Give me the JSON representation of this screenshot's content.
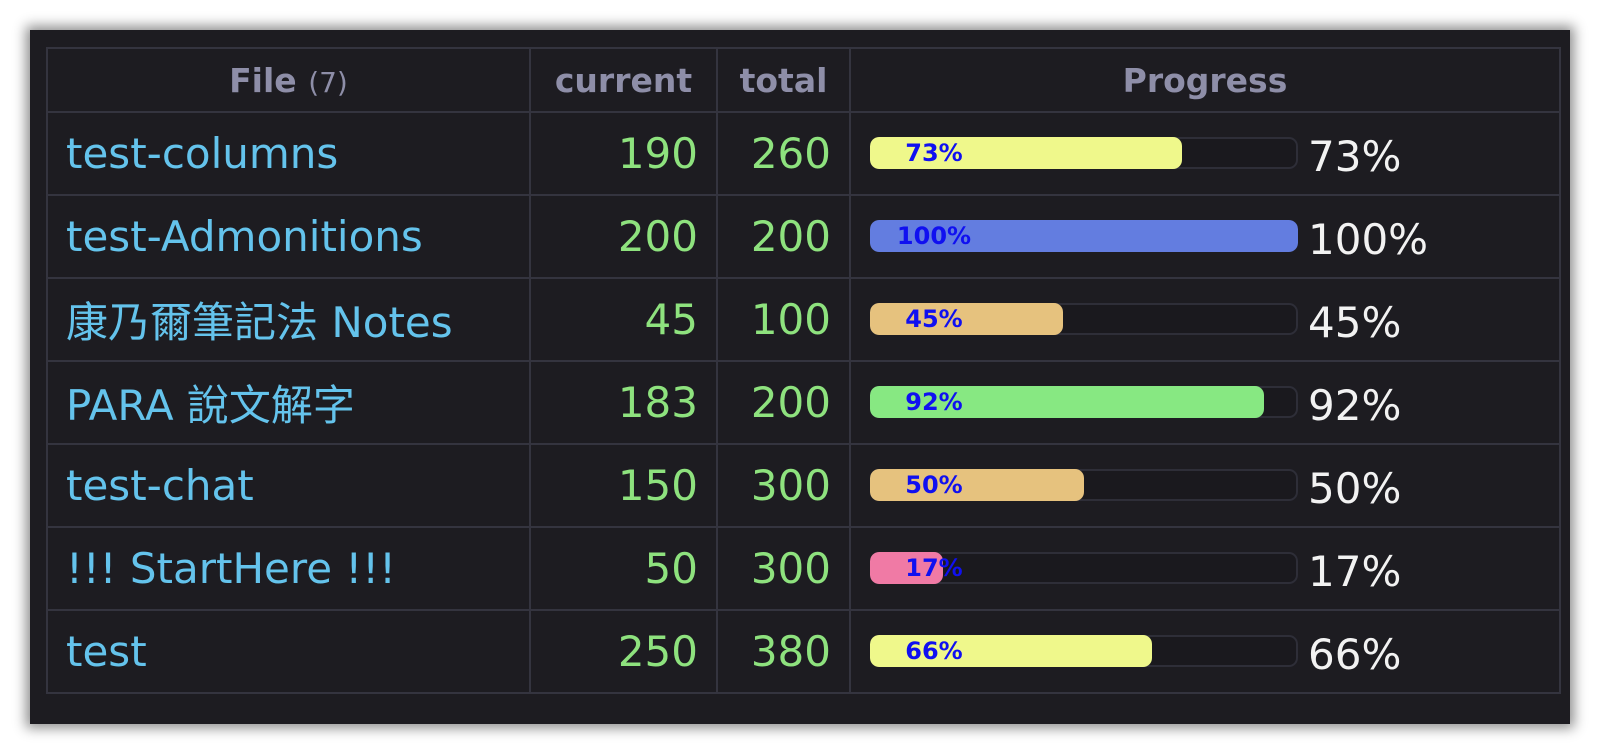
{
  "header": {
    "file_label": "File",
    "file_count": "(7)",
    "current_label": "current",
    "total_label": "total",
    "progress_label": "Progress"
  },
  "rows": [
    {
      "file": "test-columns",
      "current": "190",
      "total": "260",
      "percent": "73%",
      "progress": 0.73,
      "fill_color": "#eff88b"
    },
    {
      "file": "test-Admonitions",
      "current": "200",
      "total": "200",
      "percent": "100%",
      "progress": 1.0,
      "fill_color": "#637de0"
    },
    {
      "file": "康乃爾筆記法 Notes",
      "current": "45",
      "total": "100",
      "percent": "45%",
      "progress": 0.45,
      "fill_color": "#e6c27e"
    },
    {
      "file": "PARA 說文解字",
      "current": "183",
      "total": "200",
      "percent": "92%",
      "progress": 0.92,
      "fill_color": "#87e882"
    },
    {
      "file": "test-chat",
      "current": "150",
      "total": "300",
      "percent": "50%",
      "progress": 0.5,
      "fill_color": "#e6c27e"
    },
    {
      "file": "!!! StartHere !!!",
      "current": "50",
      "total": "300",
      "percent": "17%",
      "progress": 0.17,
      "fill_color": "#f07aa5"
    },
    {
      "file": "test",
      "current": "250",
      "total": "380",
      "percent": "66%",
      "progress": 0.66,
      "fill_color": "#eff88b"
    }
  ],
  "colors": {
    "background": "#1d1c21",
    "file_link": "#64c3ec",
    "number": "#8ee27e",
    "header_text": "#8e8ea8",
    "bar_label": "#1010f0"
  }
}
